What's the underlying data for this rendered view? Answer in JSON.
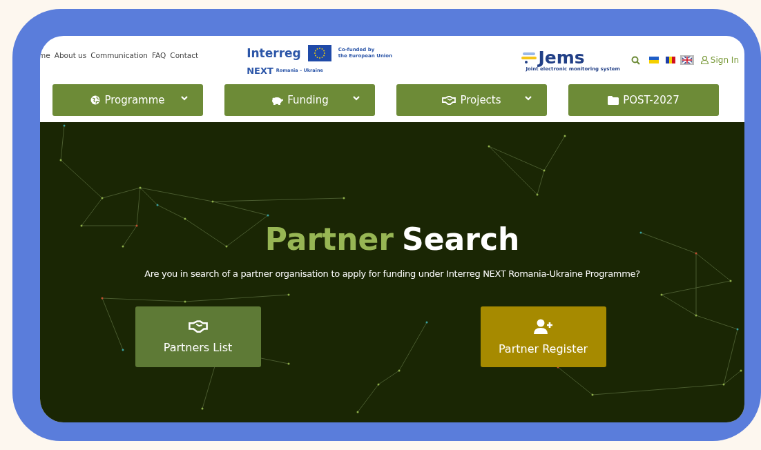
{
  "top_links": [
    "me",
    "About us",
    "Communication",
    "FAQ",
    "Contact"
  ],
  "partner_logo": {
    "name": "Interreg",
    "sub": "NEXT",
    "region": "Romania – Ukraine",
    "funding": "Co-funded by\nthe European Union"
  },
  "jems_logo": {
    "name": "Jems",
    "tagline": "Joint electronic monitoring system"
  },
  "languages": [
    {
      "selected": false
    },
    {
      "selected": false
    },
    {
      "selected": true
    }
  ],
  "sign_in": "Sign In",
  "nav": [
    {
      "label": "Programme",
      "has_menu": true
    },
    {
      "label": "Funding",
      "has_menu": true
    },
    {
      "label": "Projects",
      "has_menu": true
    },
    {
      "label": "POST-2027",
      "has_menu": false
    }
  ],
  "hero": {
    "title_highlight": "Partner",
    "title_rest": "Search",
    "subtitle": "Are you in search of a partner organisation to apply for funding under Interreg NEXT Romania-Ukraine Programme?",
    "buttons": [
      {
        "label": "Partners List",
        "color": "#5e7a36"
      },
      {
        "label": "Partner Register",
        "color": "#a68a00"
      }
    ]
  }
}
